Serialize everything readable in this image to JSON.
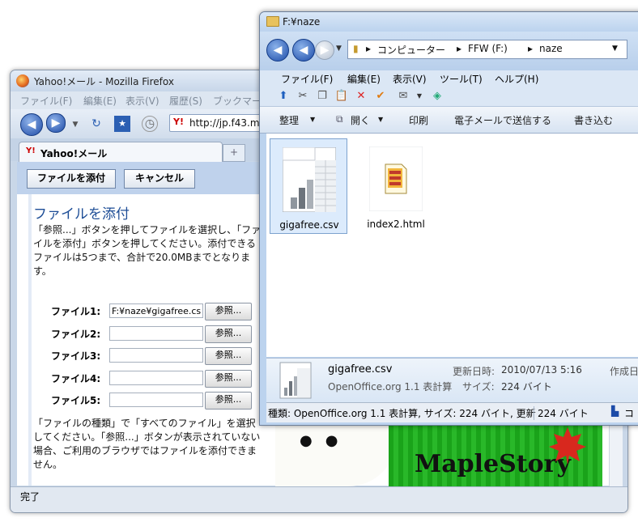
{
  "firefox": {
    "window_title": "Yahoo!メール - Mozilla Firefox",
    "menus": [
      "ファイル(F)",
      "編集(E)",
      "表示(V)",
      "履歴(S)",
      "ブックマー"
    ],
    "url": "http://jp.f43.m",
    "tab_label": "Yahoo!メール",
    "tab_logo": "Y!",
    "new_tab": "+",
    "status": "完了"
  },
  "yahoo": {
    "attach_button": "ファイルを添付",
    "cancel_button": "キャンセル",
    "heading": "ファイルを添付",
    "description": "「参照...」ボタンを押してファイルを選択し、「ファイルを添付」ボタンを押してください。添付できるファイルは5つまで、合計で20.0MBまでとなります。",
    "files": [
      {
        "label": "ファイル1:",
        "value": "F:¥naze¥gigafree.cs",
        "browse": "参照..."
      },
      {
        "label": "ファイル2:",
        "value": "",
        "browse": "参照..."
      },
      {
        "label": "ファイル3:",
        "value": "",
        "browse": "参照..."
      },
      {
        "label": "ファイル4:",
        "value": "",
        "browse": "参照..."
      },
      {
        "label": "ファイル5:",
        "value": "",
        "browse": "参照..."
      }
    ],
    "note": "「ファイルの種類」で「すべてのファイル」を選択してください。「参照...」ボタンが表示されていない場合、ご利用のブラウザではファイルを添付できません。"
  },
  "explorer": {
    "window_title": "F:¥naze",
    "breadcrumb": [
      "コンピューター",
      "FFW (F:)",
      "naze"
    ],
    "menus": [
      "ファイル(F)",
      "編集(E)",
      "表示(V)",
      "ツール(T)",
      "ヘルプ(H)"
    ],
    "commands": [
      "整理",
      "開く",
      "印刷",
      "電子メールで送信する",
      "書き込む"
    ],
    "files": [
      {
        "name": "gigafree.csv",
        "selected": true
      },
      {
        "name": "index2.html",
        "selected": false
      }
    ],
    "details": {
      "name": "gigafree.csv",
      "modified_label": "更新日時:",
      "modified_value": "2010/07/13 5:16",
      "created_label": "作成日",
      "type": "OpenOffice.org 1.1 表計算",
      "size_label": "サイズ:",
      "size_value": "224 バイト"
    },
    "status_text": "種類: OpenOffice.org 1.1 表計算, サイズ: 224 バイト, 更新",
    "status_size": "224 バイト",
    "status_right": "コ"
  },
  "background_banner": {
    "text": "MapleStory"
  },
  "colors": {
    "accent_blue": "#1d4d96",
    "selection": "#dcebfc",
    "banner_green": "#1aa31a"
  }
}
